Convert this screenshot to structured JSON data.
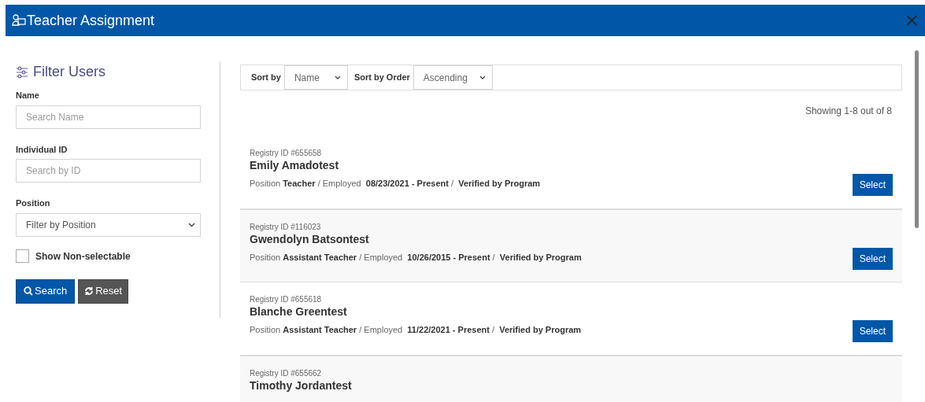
{
  "window": {
    "title": "Teacher Assignment",
    "close": "×"
  },
  "filter": {
    "title": "Filter Users",
    "fields": [
      {
        "kind": "text",
        "label": "Name",
        "placeholder": "Search Name"
      },
      {
        "kind": "text",
        "label": "Individual ID",
        "placeholder": "Search by ID"
      },
      {
        "kind": "select",
        "label": "Position",
        "value": "Filter by Position"
      }
    ],
    "show_non_selectable": {
      "label": "Show Non-selectable",
      "checked": false
    },
    "buttons": [
      {
        "kind": "search",
        "label": "Search"
      },
      {
        "kind": "reset",
        "label": "Reset"
      }
    ]
  },
  "sort": [
    {
      "label": "Sort by",
      "value": "Name"
    },
    {
      "label": "Sort by Order",
      "value": "Ascending"
    }
  ],
  "showing": "Showing 1-8 out of 8",
  "results": [
    {
      "registry": "Registry ID #655658",
      "name": "Emily Amadotest",
      "details": "Position **Teacher** / Employed  **08/23/2021 - Present** /  **Verified by Program**",
      "action": "Select"
    },
    {
      "registry": "Registry ID #116023",
      "name": "Gwendolyn Batsontest",
      "details": "Position **Assistant Teacher** / Employed  **10/26/2015 - Present** /  **Verified by Program**",
      "action": "Select"
    },
    {
      "registry": "Registry ID #655618",
      "name": "Blanche Greentest",
      "details": "Position **Assistant Teacher** / Employed  **11/22/2021 - Present** /  **Verified by Program**",
      "action": "Select"
    },
    {
      "registry": "Registry ID #655662",
      "name": "Timothy Jordantest"
    }
  ]
}
